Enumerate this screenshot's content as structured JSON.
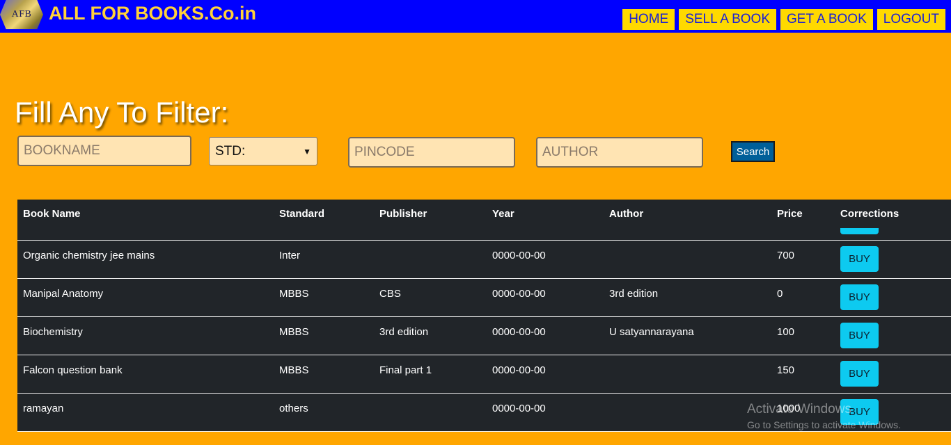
{
  "header": {
    "logo_text": "AFB",
    "brand": "ALL FOR BOOKS.Co.in",
    "nav": [
      "HOME",
      "SELL A BOOK",
      "GET A BOOK",
      "LOGOUT"
    ]
  },
  "filter": {
    "title": "Fill Any To Filter:",
    "bookname_placeholder": "BOOKNAME",
    "std_selected": "STD:",
    "pincode_placeholder": "PINCODE",
    "author_placeholder": "AUTHOR",
    "search_label": "Search"
  },
  "table": {
    "columns": [
      "Book Name",
      "Standard",
      "Publisher",
      "Year",
      "Author",
      "Price",
      "Corrections"
    ],
    "buy_label": "BUY",
    "rows": [
      {
        "name": "Organic chemistry jee mains",
        "standard": "Inter",
        "publisher": "",
        "year": "0000-00-00",
        "author": "",
        "price": "700"
      },
      {
        "name": "Manipal Anatomy",
        "standard": "MBBS",
        "publisher": "CBS",
        "year": "0000-00-00",
        "author": "3rd edition",
        "price": "0"
      },
      {
        "name": "Biochemistry",
        "standard": "MBBS",
        "publisher": "3rd edition",
        "year": "0000-00-00",
        "author": "U satyannarayana",
        "price": "100"
      },
      {
        "name": "Falcon question bank",
        "standard": "MBBS",
        "publisher": "Final part 1",
        "year": "0000-00-00",
        "author": "",
        "price": "150"
      },
      {
        "name": "ramayan",
        "standard": "others",
        "publisher": "",
        "year": "0000-00-00",
        "author": "",
        "price": "1000"
      }
    ]
  },
  "watermark": {
    "line1": "Activate Windows",
    "line2": "Go to Settings to activate Windows."
  },
  "colors": {
    "page_bg": "#ffa600",
    "header_bg": "#0000ff",
    "brand_text": "#ffd23a",
    "nav_bg": "#ffd900",
    "table_bg": "#212529",
    "buy_bg": "#0dcaf0",
    "search_bg": "#005f99"
  }
}
